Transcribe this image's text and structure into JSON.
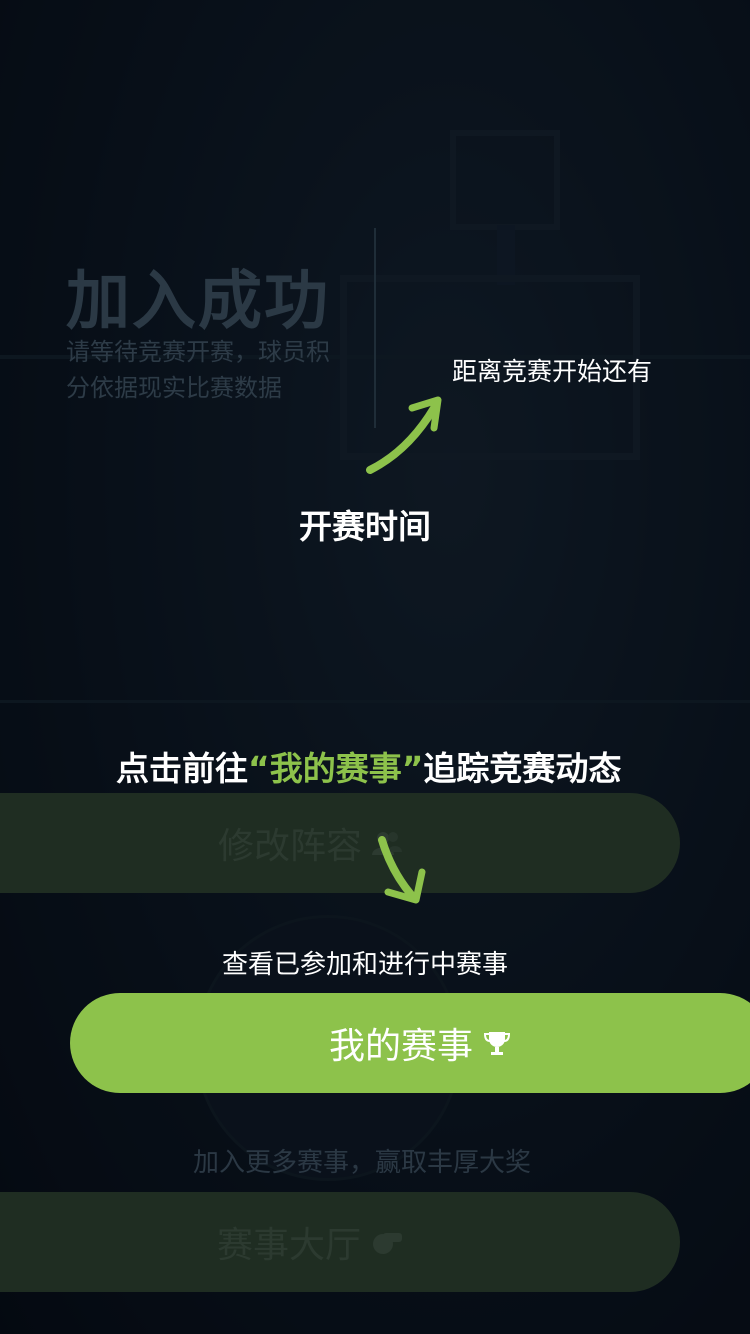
{
  "join_success": {
    "title": "加入成功",
    "subtitle": "请等待竞赛开赛，球员积分依据现实比赛数据"
  },
  "countdown": {
    "label": "距离竞赛开始还有"
  },
  "guide": {
    "start_time_label": "开赛时间",
    "promo_prefix": "点击前往",
    "promo_highlight": "“我的赛事”",
    "promo_suffix": "追踪竞赛动态",
    "view_hint": "查看已参加和进行中赛事",
    "join_more_hint": "加入更多赛事，赢取丰厚大奖"
  },
  "buttons": {
    "edit_lineup": {
      "label": "修改阵容",
      "icon": "users-icon"
    },
    "my_matches": {
      "label": "我的赛事",
      "icon": "trophy-icon"
    },
    "match_hall": {
      "label": "赛事大厅",
      "icon": "whistle-icon"
    }
  },
  "colors": {
    "accent": "#8dc24b",
    "dim_button": "#1f2d22",
    "background": "#0a1520"
  }
}
